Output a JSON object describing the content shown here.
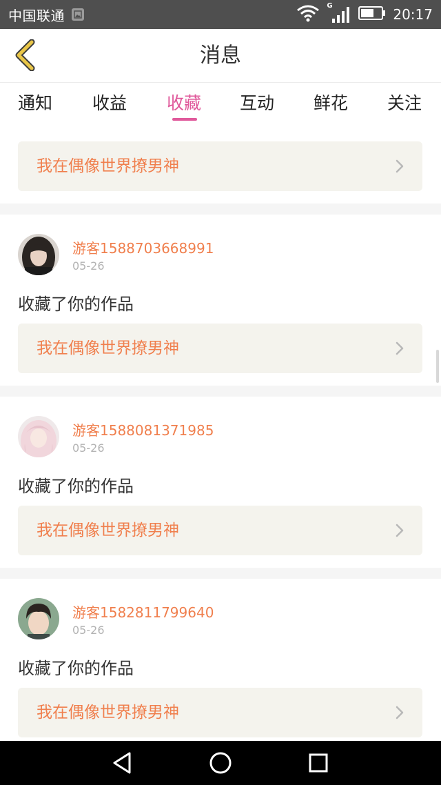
{
  "status_bar": {
    "carrier": "中国联通",
    "network_type": "G",
    "time": "20:17",
    "icons": [
      "image-notification-icon",
      "wifi-icon",
      "signal-icon",
      "battery-icon"
    ]
  },
  "header": {
    "title": "消息",
    "back_icon": "chevron-left-icon",
    "back_color": "#e9c648"
  },
  "tabs": [
    {
      "label": "通知",
      "active": false
    },
    {
      "label": "收益",
      "active": false
    },
    {
      "label": "收藏",
      "active": true
    },
    {
      "label": "互动",
      "active": false
    },
    {
      "label": "鲜花",
      "active": false
    },
    {
      "label": "关注",
      "active": false
    }
  ],
  "accent_color": "#e0599b",
  "name_color": "#f07f4d",
  "top_card": {
    "work_title": "我在偶像世界撩男神"
  },
  "messages": [
    {
      "user_name": "游客1588703668991",
      "date": "05-26",
      "action_text": "收藏了你的作品",
      "work_title": "我在偶像世界撩男神"
    },
    {
      "user_name": "游客1588081371985",
      "date": "05-26",
      "action_text": "收藏了你的作品",
      "work_title": "我在偶像世界撩男神"
    },
    {
      "user_name": "游客1582811799640",
      "date": "05-26",
      "action_text": "收藏了你的作品",
      "work_title": "我在偶像世界撩男神"
    }
  ],
  "system_nav": [
    "back-triangle-icon",
    "home-circle-icon",
    "recents-square-icon"
  ]
}
